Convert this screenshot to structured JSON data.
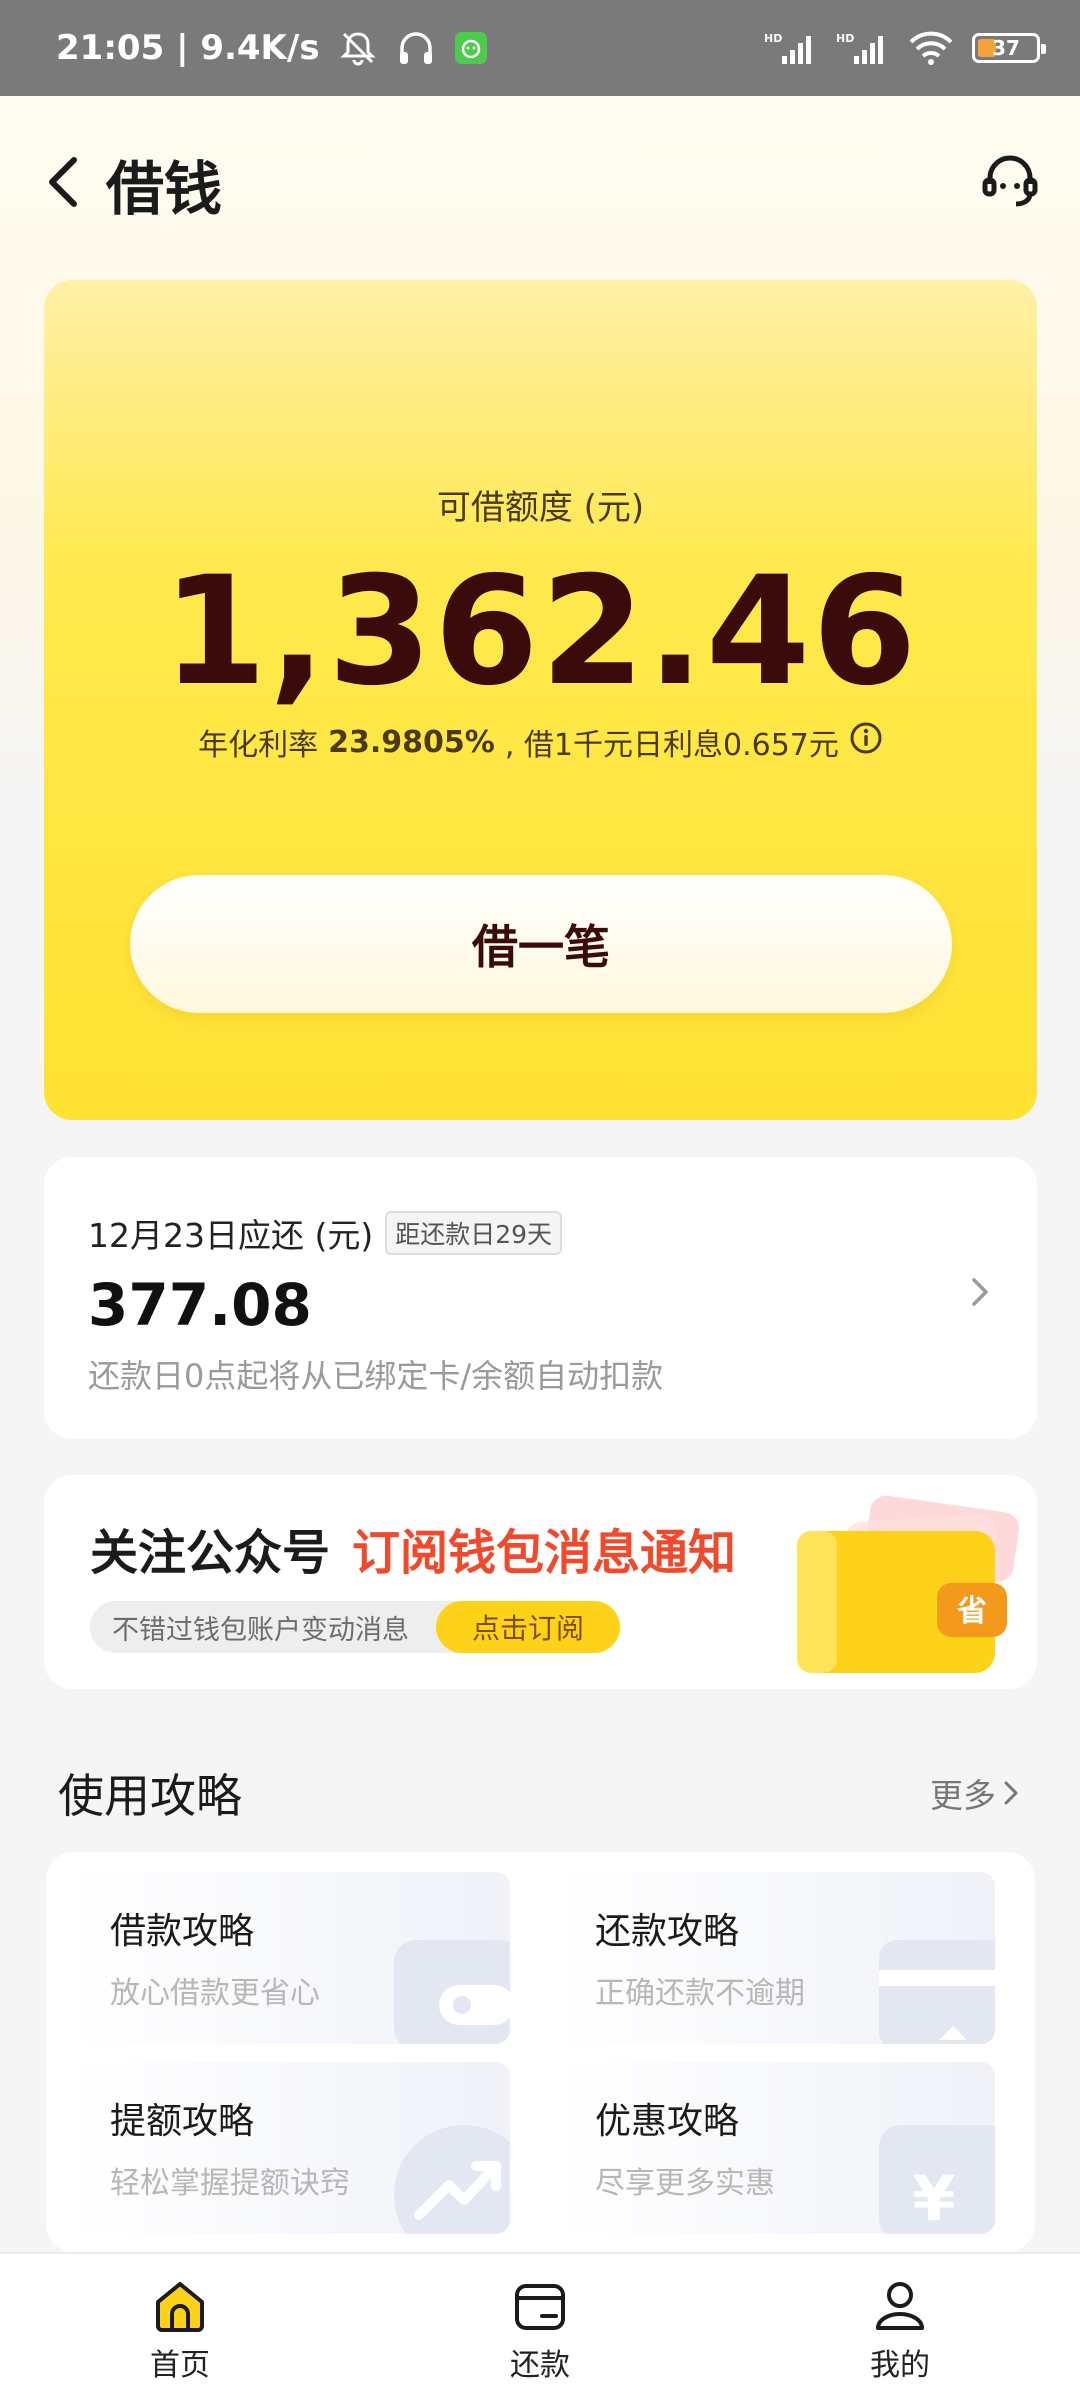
{
  "status_bar": {
    "time_speed": "21:05 | 9.4K/s",
    "battery": "37",
    "icons": [
      "mute-bell-icon",
      "headphones-icon",
      "app-notification-icon",
      "hd-signal-icon",
      "hd-signal-icon",
      "wifi-icon",
      "battery-icon"
    ]
  },
  "header": {
    "title": "借钱",
    "back_icon": "back-arrow-icon",
    "service_icon": "customer-service-icon"
  },
  "credit": {
    "label": "可借额度 (元)",
    "amount": "1,362.46",
    "rate_prefix": "年化利率",
    "rate_value": "23.9805%",
    "rate_suffix": ", 借1千元日利息0.657元",
    "info_icon": "info-icon",
    "button_label": "借一笔"
  },
  "repayment": {
    "due_label": "12月23日应还 (元)",
    "days_badge": "距还款日29天",
    "amount": "377.08",
    "note": "还款日0点起将从已绑定卡/余额自动扣款"
  },
  "follow_banner": {
    "title_prefix": "关注公众号",
    "title_highlight": "订阅钱包消息通知",
    "description": "不错过钱包账户变动消息",
    "subscribe_label": "点击订阅",
    "art_label": "省"
  },
  "guides": {
    "title": "使用攻略",
    "more_label": "更多",
    "items": [
      {
        "title": "借款攻略",
        "subtitle": "放心借款更省心"
      },
      {
        "title": "还款攻略",
        "subtitle": "正确还款不逾期"
      },
      {
        "title": "提额攻略",
        "subtitle": "轻松掌握提额诀窍"
      },
      {
        "title": "优惠攻略",
        "subtitle": "尽享更多实惠"
      }
    ]
  },
  "bottom_nav": {
    "items": [
      {
        "label": "首页",
        "icon": "home-icon",
        "active": true
      },
      {
        "label": "还款",
        "icon": "wallet-icon",
        "active": false
      },
      {
        "label": "我的",
        "icon": "profile-icon",
        "active": false
      }
    ]
  },
  "colors": {
    "card_yellow": "#ffe232",
    "amount_dark": "#3b0a0a",
    "highlight_red": "#f0492c",
    "subscribe_yellow": "#ffd21a"
  }
}
